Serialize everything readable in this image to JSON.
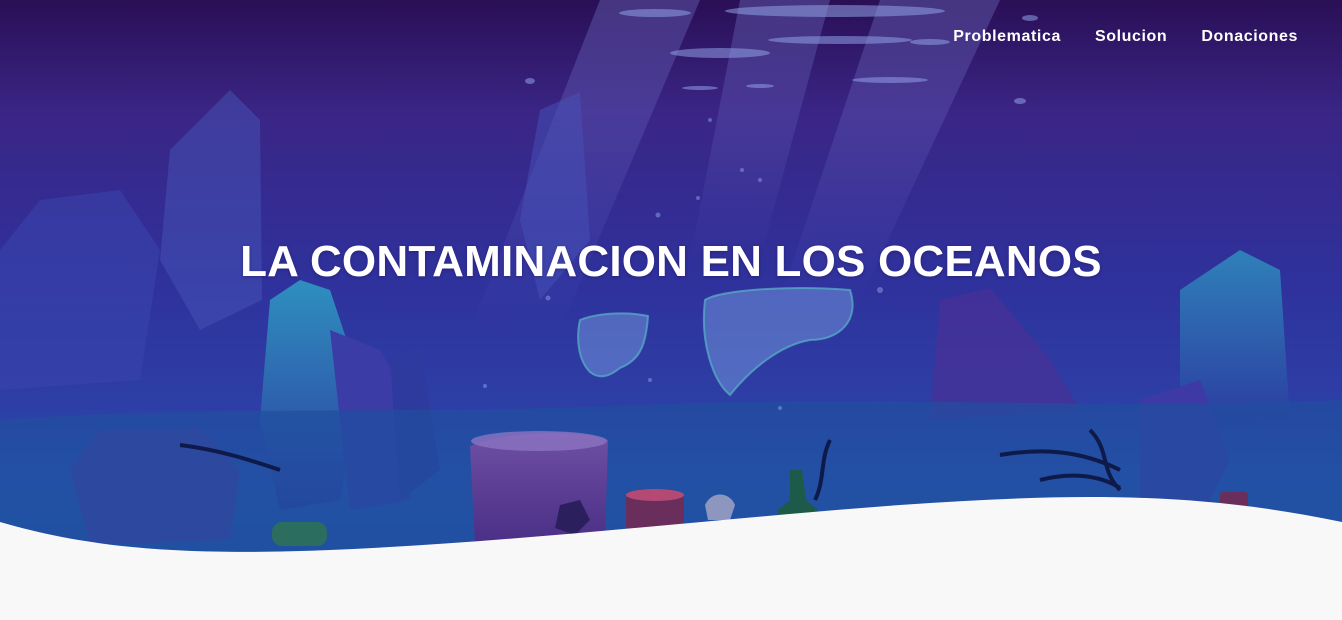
{
  "nav": {
    "items": [
      {
        "label": "Problematica"
      },
      {
        "label": "Solucion"
      },
      {
        "label": "Donaciones"
      }
    ]
  },
  "hero": {
    "title": "LA CONTAMINACION EN LOS OCEANOS",
    "background": "underwater-illustration-with-trash",
    "colors": {
      "top": "#2a0f5a",
      "mid": "#2e2f98",
      "deep": "#2845a8",
      "floor": "#1d5ea8",
      "accent_teal": "#2fa6b5"
    }
  },
  "content": {
    "background": "#f8f8f8"
  }
}
